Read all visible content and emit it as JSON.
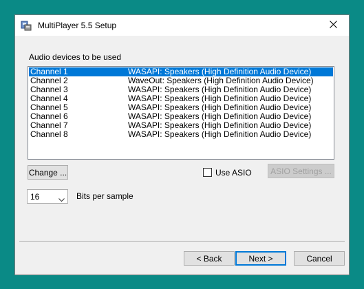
{
  "window": {
    "title": "MultiPlayer 5.5 Setup",
    "close_icon": "close-icon",
    "app_icon": "app-installer-icon"
  },
  "devices_label": "Audio devices to be used",
  "channels": [
    {
      "channel": "Channel 1",
      "device": "WASAPI: Speakers (High Definition Audio Device)",
      "selected": true
    },
    {
      "channel": "Channel 2",
      "device": "WaveOut: Speakers (High Definition Audio Device)",
      "selected": false
    },
    {
      "channel": "Channel 3",
      "device": "WASAPI: Speakers (High Definition Audio Device)",
      "selected": false
    },
    {
      "channel": "Channel 4",
      "device": "WASAPI: Speakers (High Definition Audio Device)",
      "selected": false
    },
    {
      "channel": "Channel 5",
      "device": "WASAPI: Speakers (High Definition Audio Device)",
      "selected": false
    },
    {
      "channel": "Channel 6",
      "device": "WASAPI: Speakers (High Definition Audio Device)",
      "selected": false
    },
    {
      "channel": "Channel 7",
      "device": "WASAPI: Speakers (High Definition Audio Device)",
      "selected": false
    },
    {
      "channel": "Channel 8",
      "device": "WASAPI: Speakers (High Definition Audio Device)",
      "selected": false
    }
  ],
  "change_button": "Change ...",
  "asio": {
    "label": "Use ASIO",
    "checked": false
  },
  "asio_settings_button": "ASIO Settings ...",
  "bits": {
    "value": "16",
    "label": "Bits per sample"
  },
  "buttons": {
    "back": "< Back",
    "next": "Next >",
    "cancel": "Cancel"
  },
  "colors": {
    "desktop": "#0a8a86",
    "selection": "#0078d7",
    "dialog": "#f0f0f0"
  }
}
